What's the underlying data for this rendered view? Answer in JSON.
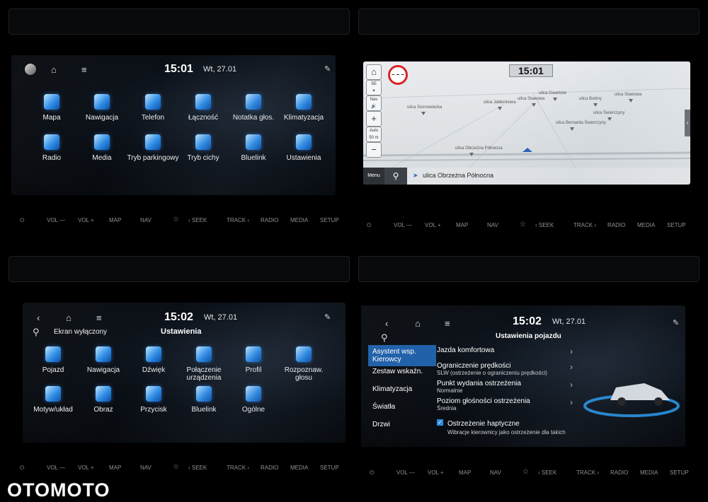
{
  "q1": {
    "time": "15:01",
    "date": "Wt, 27.01",
    "apps": [
      "Mapa",
      "Nawigacja",
      "Telefon",
      "Łączność",
      "Notatka głos.",
      "Klimatyzacja",
      "Radio",
      "Media",
      "Tryb parkingowy",
      "Tryb cichy",
      "Bluelink",
      "Ustawienia"
    ]
  },
  "q2": {
    "time": "15:01",
    "zoom_label": "Auto 50 m",
    "nav_label": "Nav",
    "se_label": "SE",
    "menu_label": "Menu",
    "current_street": "ulica Obrzeżna Północna",
    "streets": [
      "ulica Sosnowiecka",
      "ulica Jabłonkowa",
      "ulica Stawowa",
      "ulica Gwarków",
      "ulica Bolimy",
      "ulica Stawowa",
      "ulica Świerczyny",
      "ulica Bernarda Świerczyny",
      "ulica Obrzeżna Północna"
    ]
  },
  "q3": {
    "time": "15:02",
    "date": "Wt, 27.01",
    "screen_off": "Ekran wyłączony",
    "title": "Ustawienia",
    "apps": [
      "Pojazd",
      "Nawigacja",
      "Dźwięk",
      "Połączenie urządzenia",
      "Profil",
      "Rozpoznaw. głosu",
      "Motyw/układ",
      "Obraz",
      "Przycisk",
      "Bluelink",
      "Ogólne"
    ]
  },
  "q4": {
    "time": "15:02",
    "date": "Wt, 27.01",
    "title": "Ustawienia pojazdu",
    "menu": [
      "Asystent wsp. Kierowcy",
      "Zestaw wskaźn.",
      "Klimatyzacja",
      "Światła",
      "Drzwi"
    ],
    "items": [
      {
        "t": "Jazda komfortowa",
        "s": ""
      },
      {
        "t": "Ograniczenie prędkości",
        "s": "SLW (ostrzeżenie o ograniczeniu prędkości)"
      },
      {
        "t": "Punkt wydania ostrzeżenia",
        "s": "Normalnie"
      },
      {
        "t": "Poziom głośności ostrzeżenia",
        "s": "Średnia"
      }
    ],
    "haptic_label": "Ostrzeżenie haptyczne",
    "haptic_desc": "Wibracje kierownicy jako ostrzeżenie dla takich"
  },
  "hw_buttons": [
    "VOL —",
    "VOL +",
    "MAP",
    "NAV",
    "‹ SEEK",
    "TRACK ›",
    "RADIO",
    "MEDIA",
    "SETUP"
  ],
  "logo": "OTOMOTO",
  "colors": {
    "accent": "#2f8de6",
    "menu_active": "#1e5fa8",
    "check": "#2e8be0"
  }
}
